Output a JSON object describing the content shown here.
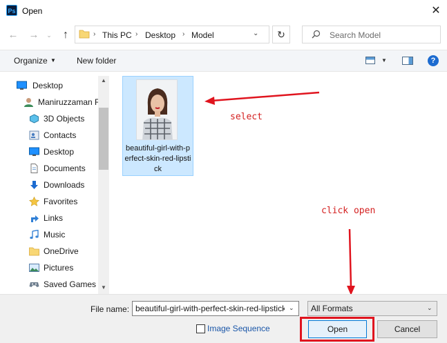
{
  "window": {
    "title": "Open",
    "app_badge": "Ps",
    "close_glyph": "✕"
  },
  "nav": {
    "back_glyph": "←",
    "forward_glyph": "→",
    "recent_glyph": "⌄",
    "up_glyph": "↑",
    "breadcrumbs": [
      "This PC",
      "Desktop",
      "Model"
    ],
    "separator": "›",
    "refresh_glyph": "↻",
    "search_placeholder": "Search Model"
  },
  "toolbar": {
    "organize_label": "Organize",
    "caret": "▼",
    "new_folder_label": "New folder",
    "help_label": "?"
  },
  "sidebar": {
    "items": [
      {
        "label": "Desktop",
        "icon": "desktop-icon"
      },
      {
        "label": "Maniruzzaman R",
        "icon": "user-icon"
      },
      {
        "label": "3D Objects",
        "icon": "3d-objects-icon"
      },
      {
        "label": "Contacts",
        "icon": "contacts-icon"
      },
      {
        "label": "Desktop",
        "icon": "desktop-icon"
      },
      {
        "label": "Documents",
        "icon": "documents-icon"
      },
      {
        "label": "Downloads",
        "icon": "downloads-icon"
      },
      {
        "label": "Favorites",
        "icon": "favorites-icon"
      },
      {
        "label": "Links",
        "icon": "links-icon"
      },
      {
        "label": "Music",
        "icon": "music-icon"
      },
      {
        "label": "OneDrive",
        "icon": "folder-icon"
      },
      {
        "label": "Pictures",
        "icon": "pictures-icon"
      },
      {
        "label": "Saved Games",
        "icon": "saved-games-icon"
      }
    ],
    "scroll_up_glyph": "▲",
    "scroll_down_glyph": "▼"
  },
  "files": [
    {
      "name": "beautiful-girl-with-perfect-skin-red-lipstick",
      "selected": true
    }
  ],
  "annotations": {
    "select_text": "select",
    "click_open_text": "click open",
    "color": "#e0141e"
  },
  "bottom": {
    "file_name_label": "File name:",
    "file_name_value": "beautiful-girl-with-perfect-skin-red-lipstick",
    "format_value": "All Formats",
    "dropdown_glyph": "⌄",
    "image_sequence_label": "Image Sequence",
    "open_label": "Open",
    "cancel_label": "Cancel"
  }
}
